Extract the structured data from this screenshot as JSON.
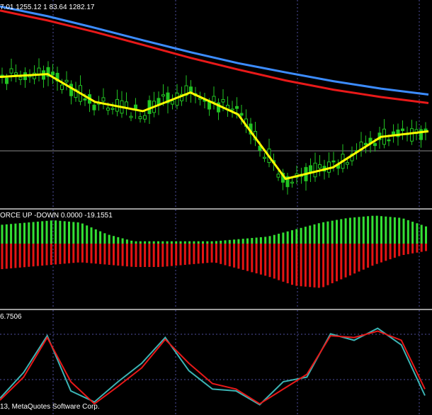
{
  "window": {
    "price_header": "7.01 1255.12 1 83.64 1282.17",
    "indicator_label": "ORCE UP -DOWN  0.0000 -19.1551",
    "stoch_label": "6.7506",
    "copyright": "13, MetaQuotes Software Corp."
  },
  "colors": {
    "background": "#000000",
    "bull_candle": "#22c322",
    "slow_ma": "#3c8cff",
    "mid_ma": "#e81919",
    "fast_ma": "#ffff00",
    "hist_up": "#34e034",
    "hist_down": "#e41414",
    "stoch_main": "#3cb4b4",
    "stoch_signal": "#e81919",
    "grid": "#5050a0"
  },
  "chart_data": [
    {
      "type": "candlestick",
      "title": "",
      "series": [
        {
          "name": "",
          "values": [
            1282.17,
            1279.4,
            1276.1,
            1272.6,
            1269.2,
            1266.1,
            1263.5,
            1261.0,
            1258.9,
            1257.2
          ]
        },
        {
          "name": "",
          "values": [
            1281.0,
            1278.2,
            1274.9,
            1271.3,
            1267.6,
            1264.3,
            1261.2,
            1258.6,
            1256.5,
            1254.8
          ]
        },
        {
          "name": "",
          "values": [
            1262.2,
            1263.0,
            1255.1,
            1252.5,
            1257.8,
            1251.6,
            1233.3,
            1236.6,
            1245.2,
            1246.8
          ]
        }
      ],
      "categories": []
    },
    {
      "type": "bar",
      "title": "",
      "series": [
        {
          "name": "",
          "values": [
            8,
            9,
            10,
            9,
            4,
            1,
            1,
            1,
            1,
            2,
            3,
            6,
            9,
            11,
            12,
            11,
            7
          ]
        },
        {
          "name": "",
          "values": [
            -11,
            -10,
            -9,
            -8,
            -9,
            -10,
            -10,
            -9,
            -8,
            -11,
            -14,
            -18,
            -19,
            -14,
            -9,
            -5,
            -3
          ]
        }
      ],
      "categories": []
    },
    {
      "type": "line",
      "title": "",
      "series": [
        {
          "name": "",
          "values": [
            12,
            40,
            80,
            20,
            8,
            30,
            50,
            78,
            42,
            22,
            20,
            5,
            30,
            35,
            82,
            75,
            88,
            70,
            15
          ]
        },
        {
          "name": "",
          "values": [
            10,
            35,
            78,
            30,
            6,
            25,
            45,
            76,
            50,
            28,
            22,
            6,
            22,
            38,
            80,
            78,
            85,
            75,
            22
          ]
        }
      ],
      "ylim": [
        0,
        100
      ],
      "categories": []
    }
  ]
}
